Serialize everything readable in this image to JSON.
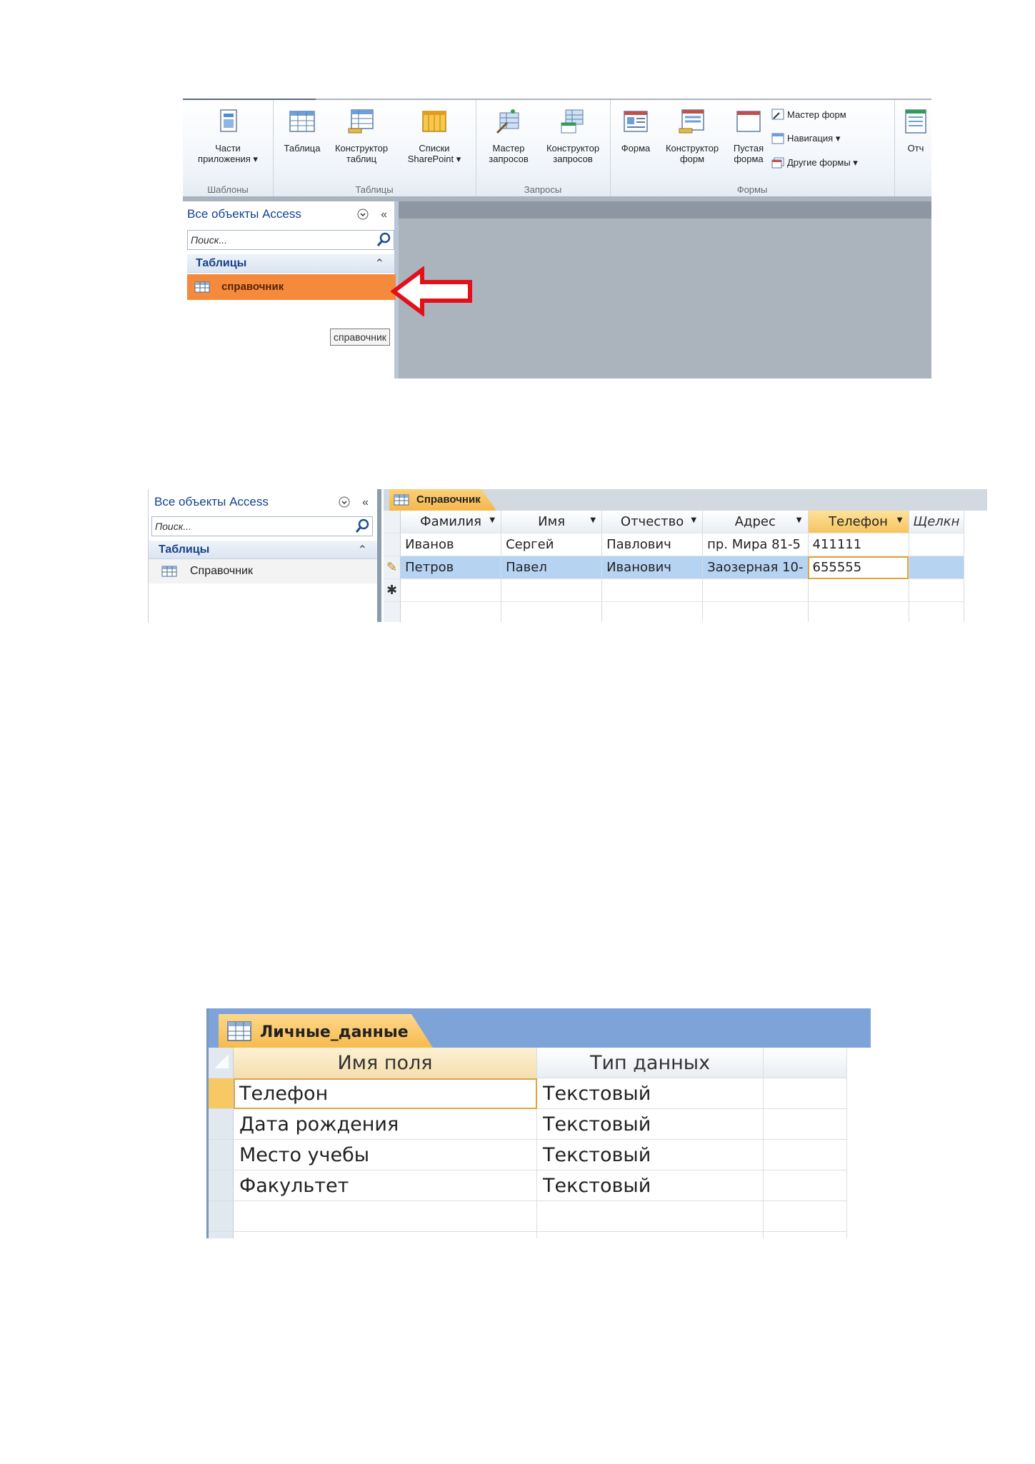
{
  "ribbon": {
    "groups": [
      {
        "label": "Шаблоны",
        "buttons": [
          {
            "line1": "Части",
            "line2": "приложения ▾"
          }
        ]
      },
      {
        "label": "Таблицы",
        "buttons": [
          {
            "line1": "Таблица",
            "line2": ""
          },
          {
            "line1": "Конструктор",
            "line2": "таблиц"
          },
          {
            "line1": "Списки",
            "line2": "SharePoint ▾"
          }
        ]
      },
      {
        "label": "Запросы",
        "buttons": [
          {
            "line1": "Мастер",
            "line2": "запросов"
          },
          {
            "line1": "Конструктор",
            "line2": "запросов"
          }
        ]
      },
      {
        "label": "Формы",
        "buttons": [
          {
            "line1": "Форма",
            "line2": ""
          },
          {
            "line1": "Конструктор",
            "line2": "форм"
          },
          {
            "line1": "Пустая",
            "line2": "форма"
          }
        ],
        "small_buttons": [
          "Мастер форм",
          "Навигация ▾",
          "Другие формы ▾"
        ]
      },
      {
        "label": "",
        "buttons": [
          {
            "line1": "Отч",
            "line2": ""
          }
        ]
      }
    ]
  },
  "nav1": {
    "title": "Все объекты Access",
    "collapse": "«",
    "menu": "⌄",
    "search_placeholder": "Поиск...",
    "group": "Таблицы",
    "group_chevron": "⌃",
    "item": "справочник",
    "tooltip": "справочник"
  },
  "nav2": {
    "title": "Все объекты Access",
    "collapse": "«",
    "search_placeholder": "Поиск...",
    "group": "Таблицы",
    "item": "Справочник"
  },
  "datasheet": {
    "tab": "Справочник",
    "columns": [
      "Фамилия",
      "Имя",
      "Отчество",
      "Адрес",
      "Телефон",
      "Щелкн"
    ],
    "rows": [
      [
        "Иванов",
        "Сергей",
        "Павлович",
        "пр. Мира 81-5",
        "411111"
      ],
      [
        "Петров",
        "Павел",
        "Иванович",
        "Заозерная 10-",
        "655555"
      ]
    ],
    "editing_marker": "✎",
    "new_marker": "✱"
  },
  "design": {
    "tab": "Личные_данные",
    "columns": [
      "Имя поля",
      "Тип данных"
    ],
    "rows": [
      [
        "Телефон",
        "Текстовый"
      ],
      [
        "Дата рождения",
        "Текстовый"
      ],
      [
        "Место учебы",
        "Текстовый"
      ],
      [
        "Факультет",
        "Текстовый"
      ]
    ]
  },
  "colors": {
    "highlight": "#f58a3c",
    "arrow": "#e3101a",
    "access_blue": "#15428b"
  }
}
